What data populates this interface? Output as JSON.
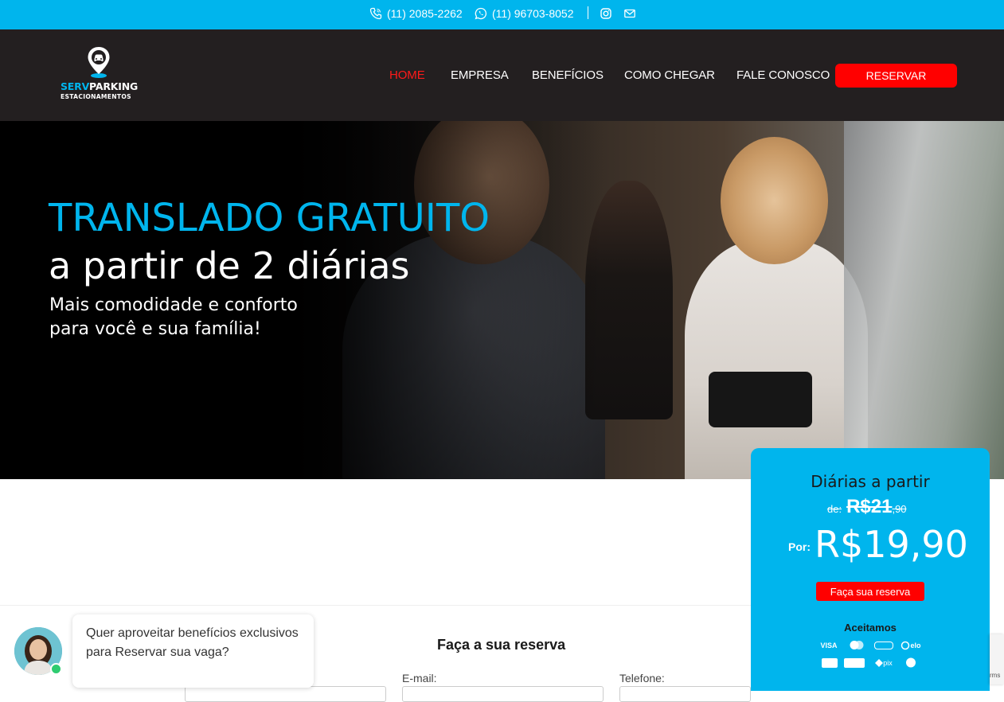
{
  "topbar": {
    "phone1": "(11) 2085-2262",
    "phone2": "(11) 96703-8052",
    "icons": [
      "phone-icon",
      "whatsapp-icon",
      "instagram-icon",
      "mail-icon"
    ]
  },
  "header": {
    "logo": {
      "brand_part1": "SERV",
      "brand_part2": "PARKING",
      "tagline": "ESTACIONAMENTOS"
    },
    "nav": [
      {
        "label": "HOME",
        "active": true
      },
      {
        "label": "EMPRESA",
        "active": false
      },
      {
        "label": "BENEFÍCIOS",
        "active": false
      },
      {
        "label": "COMO CHEGAR",
        "active": false
      },
      {
        "label": "FALE CONOSCO",
        "active": false
      }
    ],
    "cta": "RESERVAR"
  },
  "hero": {
    "title": "TRANSLADO GRATUITO",
    "subtitle": "a partir de 2 diárias",
    "text_line1": "Mais comodidade e conforto",
    "text_line2": "para você e sua família!"
  },
  "price_card": {
    "title": "Diárias a partir",
    "old_prefix": "de:",
    "old_price": "R$21",
    "old_cents": ",90",
    "new_prefix": "Por:",
    "new_price": "R$19,90",
    "cta": "Faça sua reserva",
    "accepted_title": "Aceitamos",
    "payment_methods": [
      "VISA",
      "mastercard",
      "amex",
      "elo",
      "diners",
      "hipercard",
      "pix",
      "alelo"
    ]
  },
  "form": {
    "title": "Faça a sua reserva",
    "email_label": "E-mail:",
    "phone_label": "Telefone:"
  },
  "chat": {
    "message": "Quer aproveitar benefícios exclusivos para Reservar sua vaga?"
  },
  "recaptcha": {
    "text": "rms"
  },
  "colors": {
    "accent": "#00b5ed",
    "cta": "#ff0000",
    "header_bg": "#231f20",
    "active_nav": "#ff1a1a"
  }
}
